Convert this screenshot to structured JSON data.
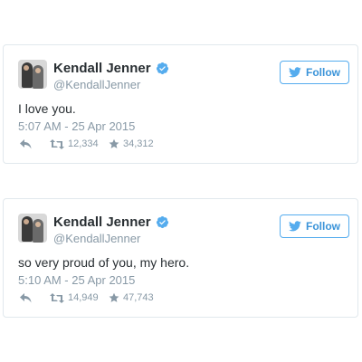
{
  "colors": {
    "accent": "#55acee",
    "accent_text": "#3b94d9",
    "name": "#292f33",
    "muted": "#8899a6",
    "border": "#e1e8ed"
  },
  "tweets": [
    {
      "author_name": "Kendall Jenner",
      "handle": "@KendallJenner",
      "follow_label": "Follow",
      "text": "I love you.",
      "timestamp": "5:07 AM - 25 Apr 2015",
      "retweets": "12,334",
      "favorites": "34,312",
      "icons": [
        "avatar",
        "verified-badge-icon",
        "bird-icon",
        "reply-icon",
        "retweet-icon",
        "star-icon"
      ]
    },
    {
      "author_name": "Kendall Jenner",
      "handle": "@KendallJenner",
      "follow_label": "Follow",
      "text": "so very proud of you, my hero.",
      "timestamp": "5:10 AM - 25 Apr 2015",
      "retweets": "14,949",
      "favorites": "47,743",
      "icons": [
        "avatar",
        "verified-badge-icon",
        "bird-icon",
        "reply-icon",
        "retweet-icon",
        "star-icon"
      ]
    }
  ]
}
